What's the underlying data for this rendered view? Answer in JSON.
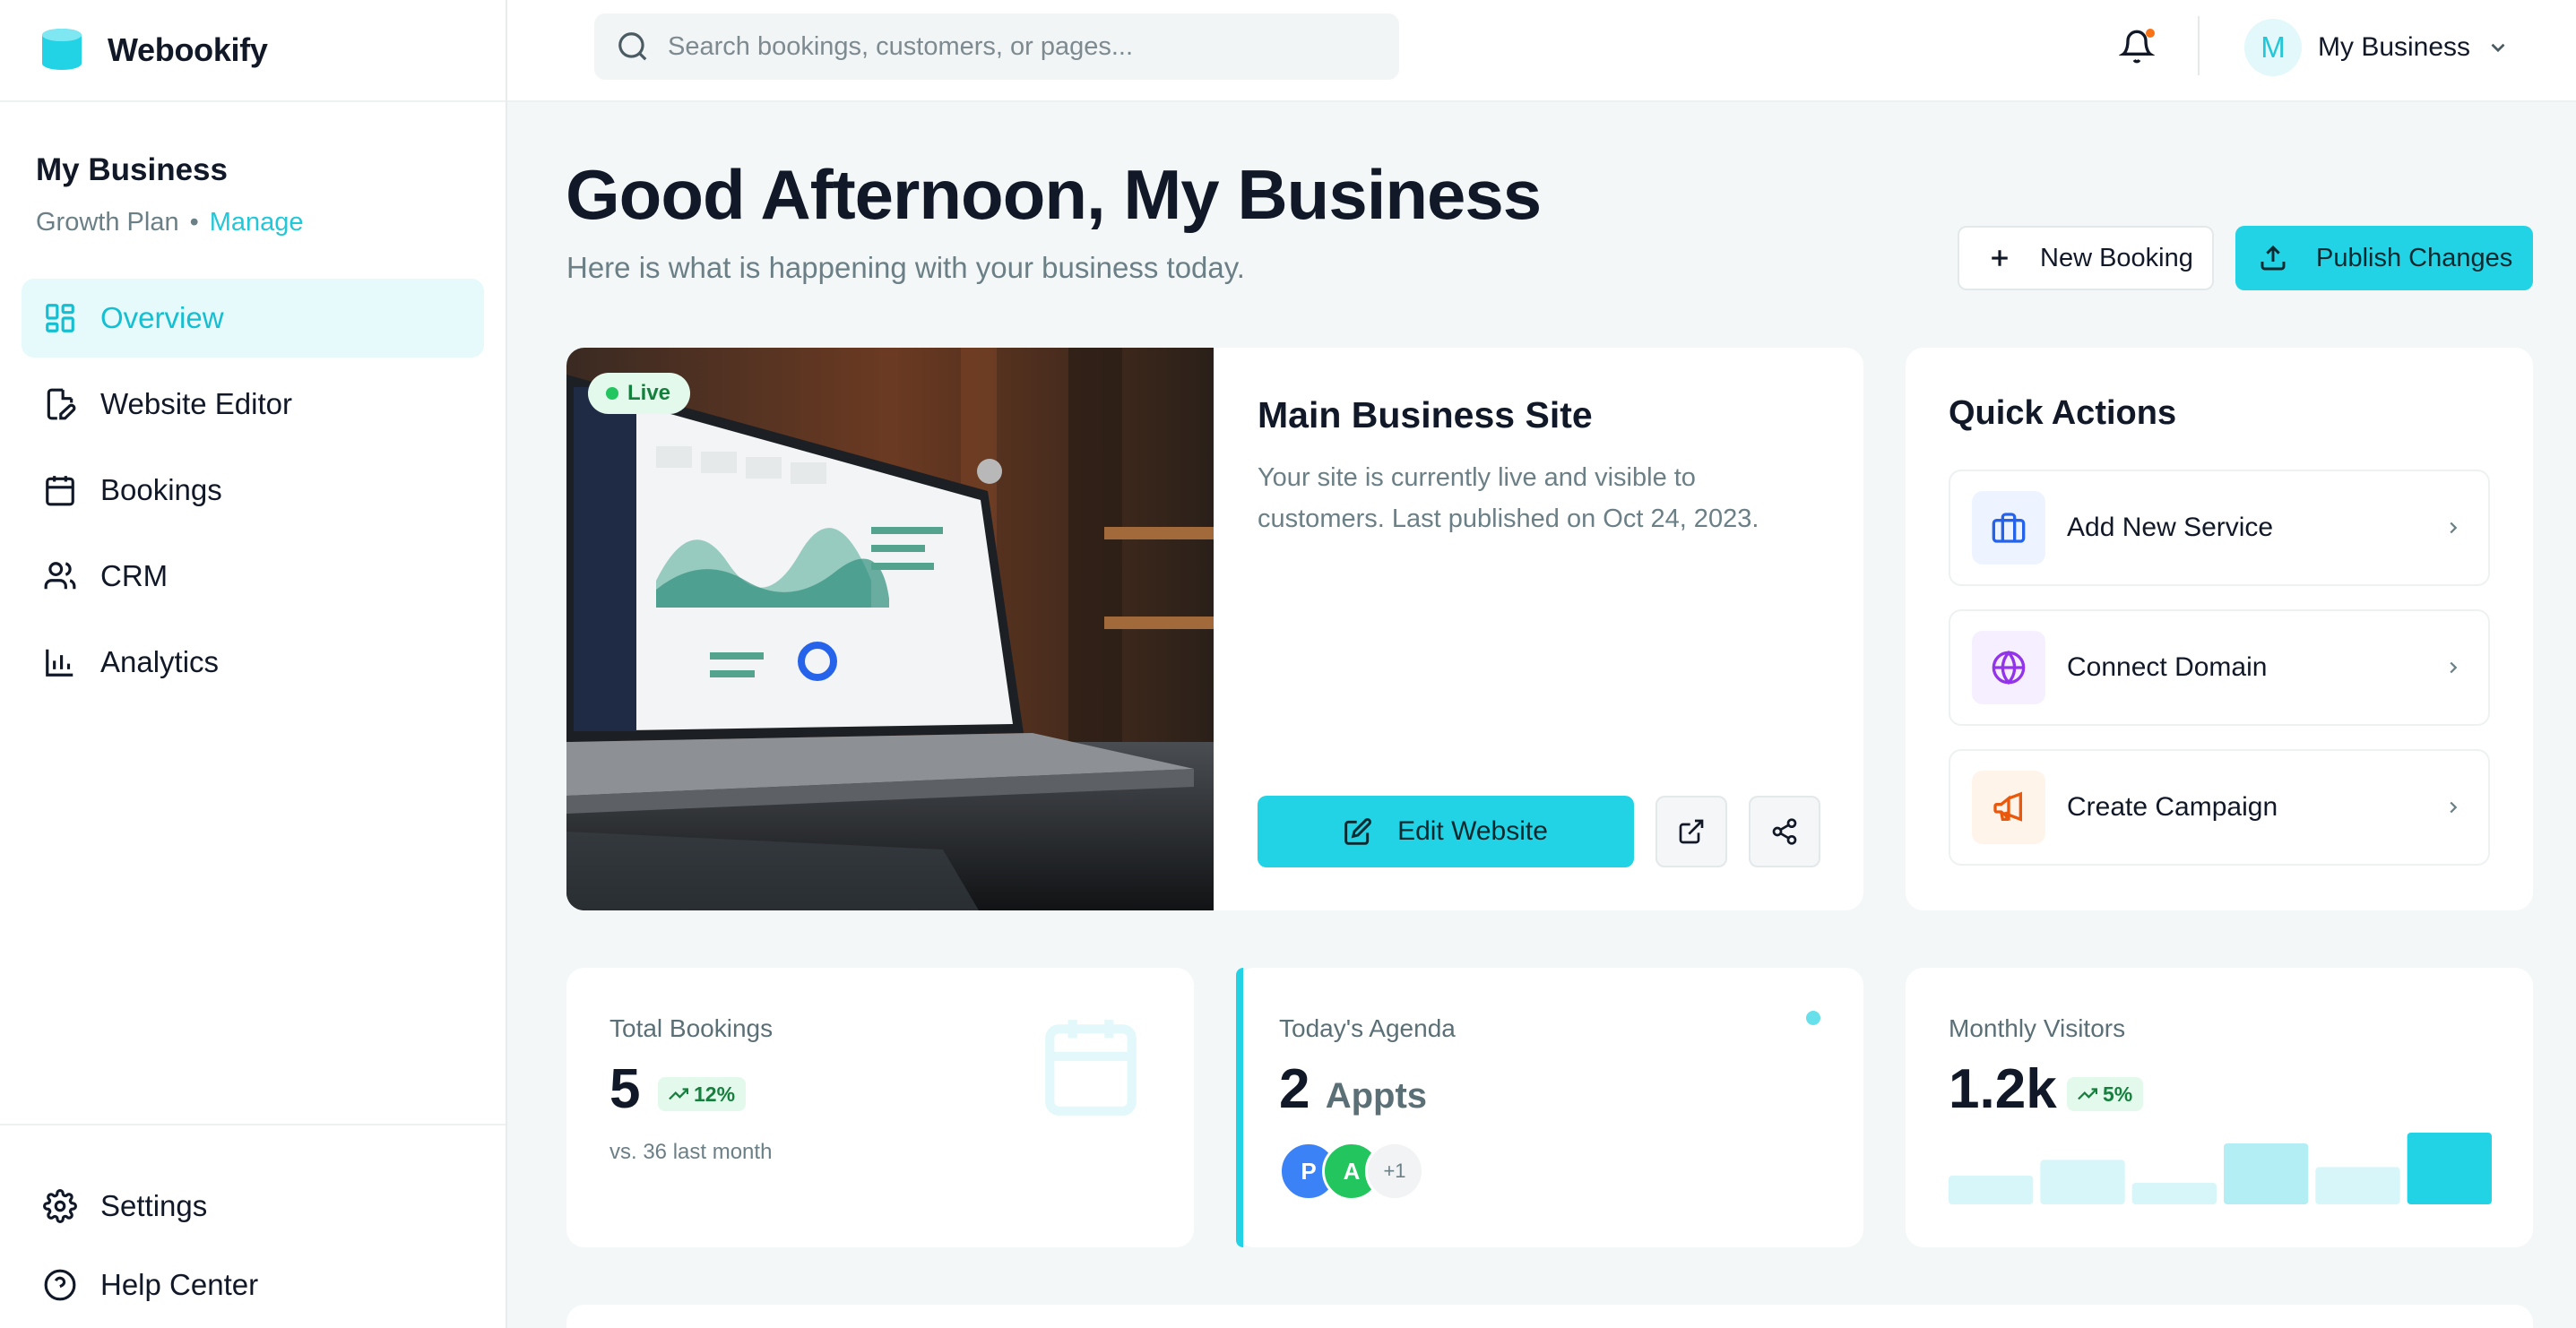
{
  "brand": {
    "name": "Webookify"
  },
  "sidebar": {
    "business_name": "My Business",
    "plan": "Growth Plan",
    "separator": "•",
    "manage_link": "Manage",
    "items": [
      {
        "label": "Overview",
        "icon": "dashboard-icon",
        "active": true
      },
      {
        "label": "Website Editor",
        "icon": "file-edit-icon",
        "active": false
      },
      {
        "label": "Bookings",
        "icon": "calendar-icon",
        "active": false
      },
      {
        "label": "CRM",
        "icon": "users-icon",
        "active": false
      },
      {
        "label": "Analytics",
        "icon": "bar-chart-icon",
        "active": false
      }
    ],
    "bottom_items": [
      {
        "label": "Settings",
        "icon": "gear-icon"
      },
      {
        "label": "Help Center",
        "icon": "help-circle-icon"
      }
    ]
  },
  "topbar": {
    "search_placeholder": "Search bookings, customers, or pages...",
    "search_value": "",
    "account_initial": "M",
    "account_name": "My Business"
  },
  "header": {
    "greeting": "Good Afternoon, My Business",
    "subtitle": "Here is what is happening with your business today.",
    "new_booking_label": "New Booking",
    "publish_label": "Publish Changes"
  },
  "site": {
    "status": "Live",
    "title": "Main Business Site",
    "description": "Your site is currently live and visible to customers. Last published on Oct 24, 2023.",
    "edit_label": "Edit Website"
  },
  "quick_actions": {
    "title": "Quick Actions",
    "items": [
      {
        "label": "Add New Service",
        "icon": "briefcase-icon",
        "color": "#2563eb",
        "bg": "#eef4ff"
      },
      {
        "label": "Connect Domain",
        "icon": "globe-icon",
        "color": "#9333ea",
        "bg": "#f6efff"
      },
      {
        "label": "Create Campaign",
        "icon": "megaphone-icon",
        "color": "#ea580c",
        "bg": "#fff4ea"
      }
    ]
  },
  "stats": {
    "bookings": {
      "label": "Total Bookings",
      "value": "5",
      "trend": "12%",
      "sub": "vs. 36 last month"
    },
    "agenda": {
      "label": "Today's Agenda",
      "value": "2",
      "unit": "Appts",
      "people": [
        "P",
        "A"
      ],
      "more": "+1"
    },
    "visitors": {
      "label": "Monthly Visitors",
      "value": "1.2k",
      "trend": "5%",
      "bars": [
        0.4,
        0.62,
        0.3,
        0.85,
        0.52,
        1.0
      ]
    }
  },
  "colors": {
    "accent": "#22d3e6",
    "accent_text": "#14bfd2",
    "success": "#15803d"
  }
}
